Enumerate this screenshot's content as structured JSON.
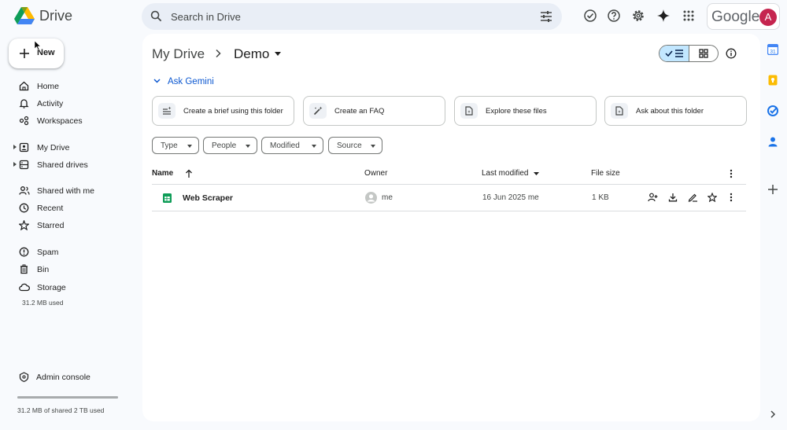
{
  "app": {
    "name": "Drive"
  },
  "search": {
    "placeholder": "Search in Drive"
  },
  "account": {
    "brand": "Google",
    "initial": "A"
  },
  "sidebar": {
    "new_label": "New",
    "items": [
      {
        "label": "Home"
      },
      {
        "label": "Activity"
      },
      {
        "label": "Workspaces"
      },
      {
        "label": "My Drive"
      },
      {
        "label": "Shared drives"
      },
      {
        "label": "Shared with me"
      },
      {
        "label": "Recent"
      },
      {
        "label": "Starred"
      },
      {
        "label": "Spam"
      },
      {
        "label": "Bin"
      },
      {
        "label": "Storage"
      }
    ],
    "storage_used": "31.2 MB used",
    "admin_label": "Admin console",
    "quota_text": "31.2 MB of shared 2 TB used"
  },
  "breadcrumb": {
    "root": "My Drive",
    "current": "Demo"
  },
  "gemini": {
    "toggle_label": "Ask Gemini",
    "cards": [
      {
        "label": "Create a brief using this folder"
      },
      {
        "label": "Create an FAQ"
      },
      {
        "label": "Explore these files"
      },
      {
        "label": "Ask about this folder"
      }
    ]
  },
  "filters": [
    {
      "label": "Type"
    },
    {
      "label": "People"
    },
    {
      "label": "Modified"
    },
    {
      "label": "Source"
    }
  ],
  "table": {
    "headers": {
      "name": "Name",
      "owner": "Owner",
      "modified": "Last modified",
      "size": "File size"
    },
    "rows": [
      {
        "name": "Web Scraper",
        "owner": "me",
        "modified": "16 Jun 2025 me",
        "size": "1 KB"
      }
    ]
  },
  "colors": {
    "accent": "#0b57d0",
    "selected_toggle": "#c2e7ff",
    "avatar": "#c5254f",
    "sheets_green": "#0f9d58"
  },
  "icons": [
    "drive-logo",
    "search-icon",
    "tune-icon",
    "ready-offline-icon",
    "help-icon",
    "settings-icon",
    "gemini-sparkle-icon",
    "apps-grid-icon"
  ]
}
